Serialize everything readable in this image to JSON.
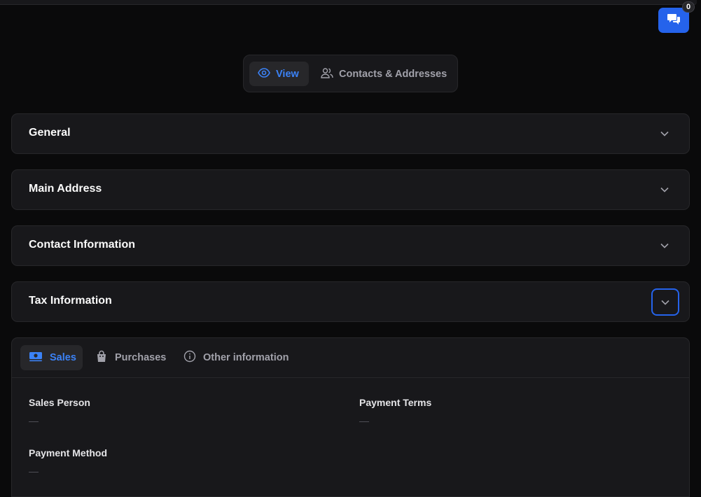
{
  "chat": {
    "badge_count": "0",
    "icon": "chat-bubbles-icon"
  },
  "view_tabs": [
    {
      "label": "View",
      "icon": "eye-icon",
      "active": true
    },
    {
      "label": "Contacts & Addresses",
      "icon": "users-icon",
      "active": false
    }
  ],
  "sections": [
    {
      "title": "General"
    },
    {
      "title": "Main Address"
    },
    {
      "title": "Contact Information"
    },
    {
      "title": "Tax Information"
    }
  ],
  "panel": {
    "tabs": [
      {
        "label": "Sales",
        "icon": "money-icon",
        "active": true
      },
      {
        "label": "Purchases",
        "icon": "shopping-bag-icon",
        "active": false
      },
      {
        "label": "Other information",
        "icon": "info-icon",
        "active": false
      }
    ],
    "fields": [
      {
        "label": "Sales Person",
        "value": "—"
      },
      {
        "label": "Payment Terms",
        "value": "—"
      },
      {
        "label": "Payment Method",
        "value": "—"
      }
    ]
  },
  "colors": {
    "accent": "#3b82f6",
    "button": "#2563eb",
    "surface": "#18181b",
    "background": "#0a0a0b"
  }
}
